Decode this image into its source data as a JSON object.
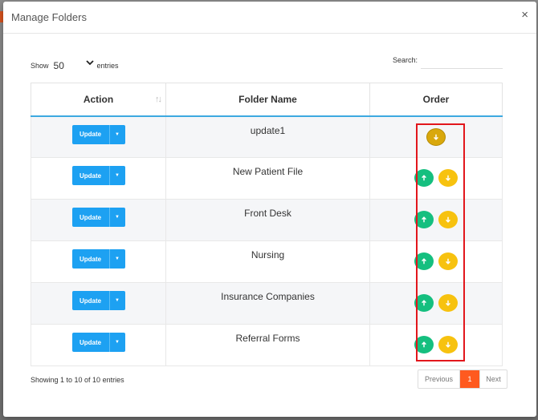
{
  "modal": {
    "title": "Manage Folders",
    "close_glyph": "×"
  },
  "controls": {
    "show_label": "Show",
    "entries_value": "50",
    "entries_label": "entries",
    "search_label": "Search:",
    "search_value": ""
  },
  "table": {
    "headers": {
      "action": "Action",
      "name": "Folder Name",
      "order": "Order"
    },
    "rows": [
      {
        "update_label": "Update",
        "name": "update1",
        "has_up": false,
        "has_down": true
      },
      {
        "update_label": "Update",
        "name": "New Patient File",
        "has_up": true,
        "has_down": true
      },
      {
        "update_label": "Update",
        "name": "Front Desk",
        "has_up": true,
        "has_down": true
      },
      {
        "update_label": "Update",
        "name": "Nursing",
        "has_up": true,
        "has_down": true
      },
      {
        "update_label": "Update",
        "name": "Insurance Companies",
        "has_up": true,
        "has_down": true
      },
      {
        "update_label": "Update",
        "name": "Referral Forms",
        "has_up": true,
        "has_down": true
      }
    ]
  },
  "footer": {
    "info": "Showing 1 to 10 of 10 entries",
    "previous": "Previous",
    "current_page": "1",
    "next": "Next"
  },
  "colors": {
    "update_button": "#1da1f2",
    "order_up": "#15bf7f",
    "order_down": "#f7c20f",
    "highlight": "#e2161c",
    "current_page": "#ff5a1f"
  }
}
